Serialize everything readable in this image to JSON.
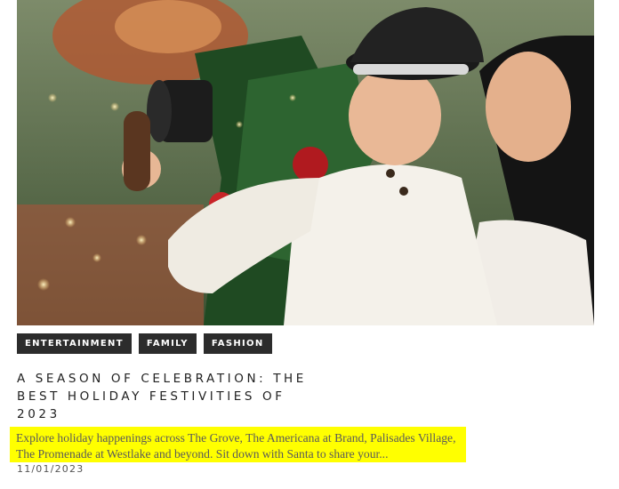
{
  "article": {
    "tags": [
      "ENTERTAINMENT",
      "FAMILY",
      "FASHION"
    ],
    "title": "A SEASON OF CELEBRATION: THE BEST HOLIDAY FESTIVITIES OF 2023",
    "excerpt": "Explore holiday happenings across The Grove, The Americana at Brand, Palisades Village, The Promenade at Westlake and beyond. Sit down with Santa to share your...",
    "date": "11/01/2023"
  },
  "colors": {
    "tag_bg": "#2c2c2c",
    "highlight": "#ffff00"
  }
}
